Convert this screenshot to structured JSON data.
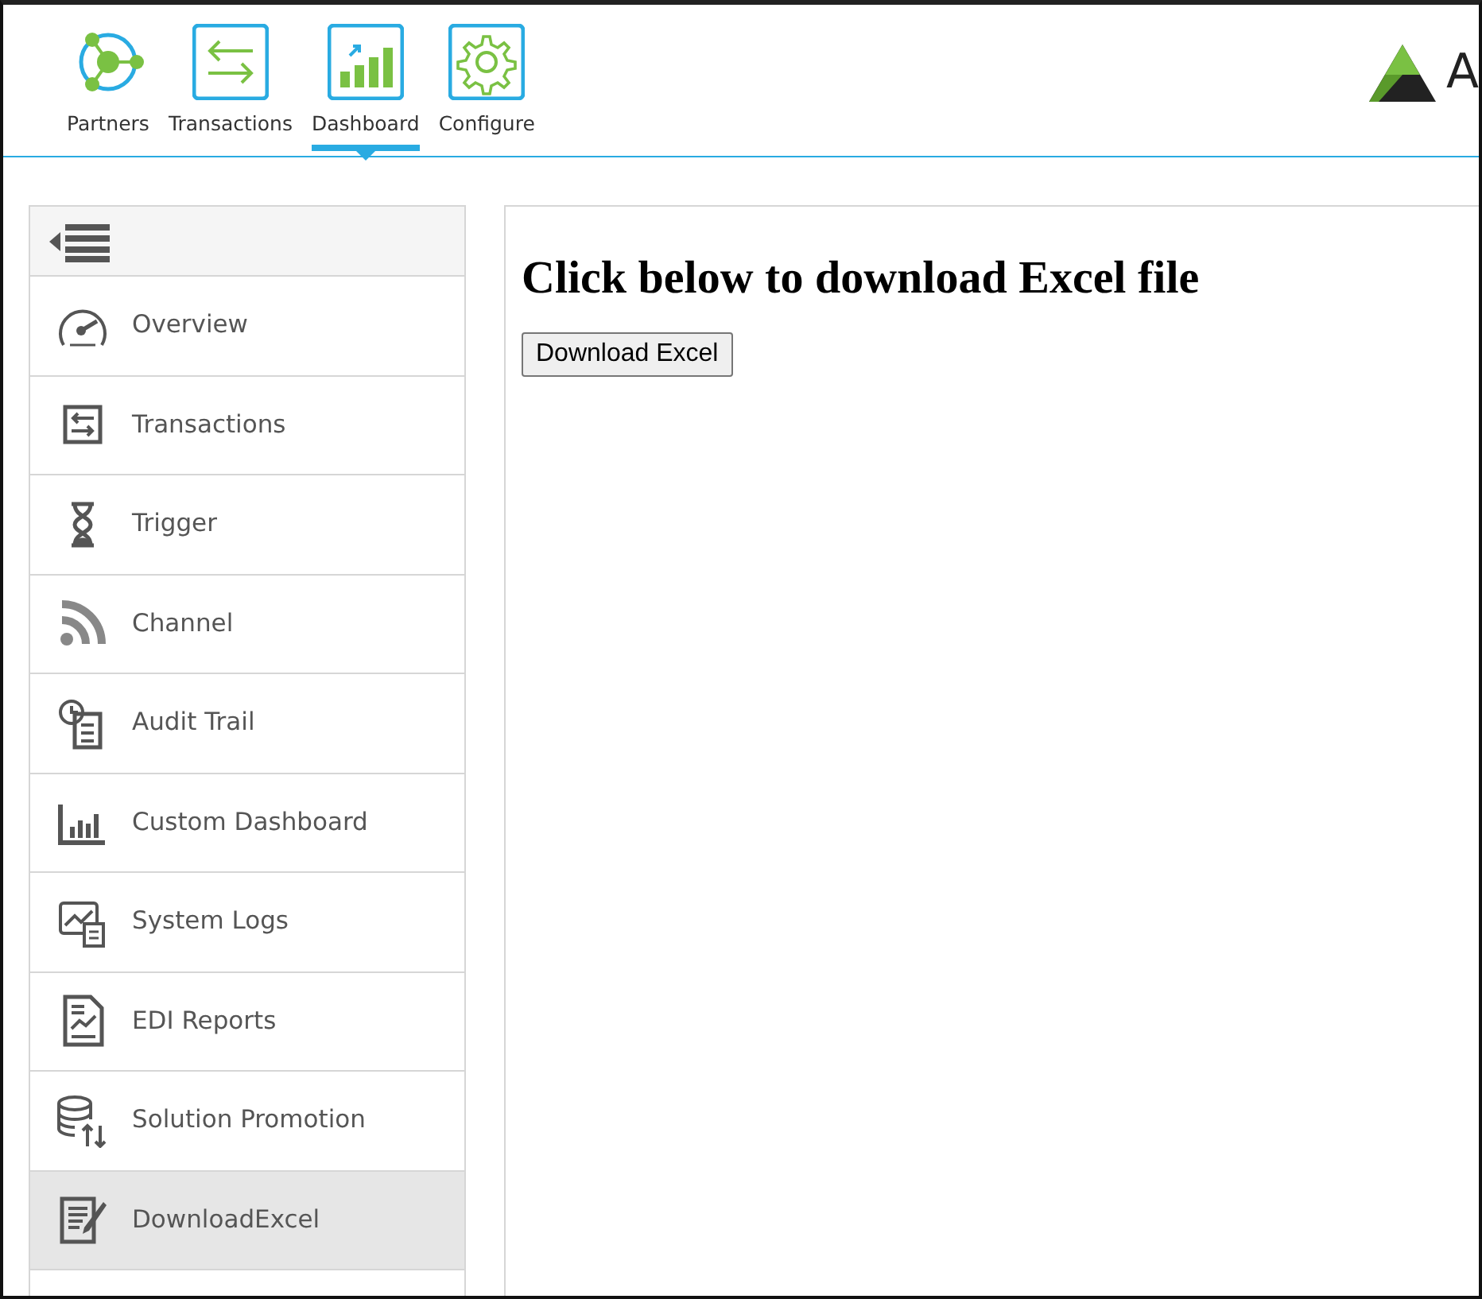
{
  "top_nav": [
    {
      "label": "Partners",
      "selected": false
    },
    {
      "label": "Transactions",
      "selected": false
    },
    {
      "label": "Dashboard",
      "selected": true
    },
    {
      "label": "Configure",
      "selected": false
    }
  ],
  "logo": {
    "text": "A"
  },
  "sidebar": {
    "items": [
      {
        "label": "Overview",
        "selected": false
      },
      {
        "label": "Transactions",
        "selected": false
      },
      {
        "label": "Trigger",
        "selected": false
      },
      {
        "label": "Channel",
        "selected": false
      },
      {
        "label": "Audit Trail",
        "selected": false
      },
      {
        "label": "Custom Dashboard",
        "selected": false
      },
      {
        "label": "System Logs",
        "selected": false
      },
      {
        "label": "EDI Reports",
        "selected": false
      },
      {
        "label": "Solution Promotion",
        "selected": false
      },
      {
        "label": "DownloadExcel",
        "selected": true
      }
    ]
  },
  "content": {
    "heading": "Click below to download Excel file",
    "button": "Download Excel"
  }
}
